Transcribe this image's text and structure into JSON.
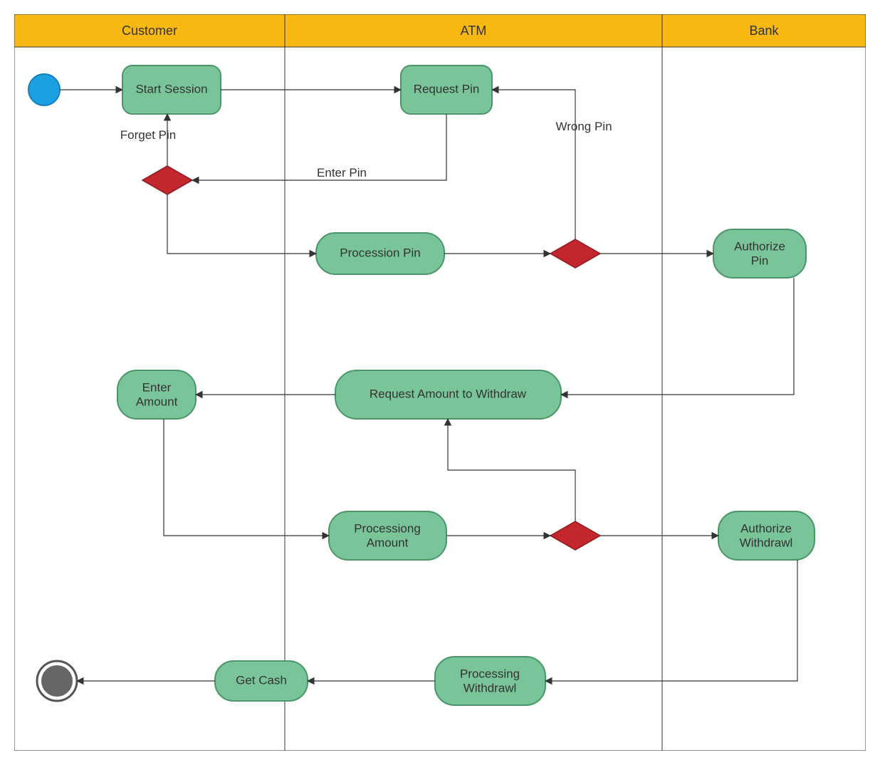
{
  "lanes": {
    "customer": "Customer",
    "atm": "ATM",
    "bank": "Bank"
  },
  "nodes": {
    "start_session": "Start Session",
    "request_pin": "Request Pin",
    "procession_pin": "Procession Pin",
    "authorize_pin_l1": "Authorize",
    "authorize_pin_l2": "Pin",
    "enter_amount_l1": "Enter",
    "enter_amount_l2": "Amount",
    "request_amount": "Request Amount to Withdraw",
    "processing_amount_l1": "Processiong",
    "processing_amount_l2": "Amount",
    "authorize_withdrawl_l1": "Authorize",
    "authorize_withdrawl_l2": "Withdrawl",
    "processing_withdrawl_l1": "Processing",
    "processing_withdrawl_l2": "Withdrawl",
    "get_cash": "Get Cash"
  },
  "edges": {
    "forget_pin": "Forget Pin",
    "enter_pin": "Enter Pin",
    "wrong_pin": "Wrong Pin"
  }
}
